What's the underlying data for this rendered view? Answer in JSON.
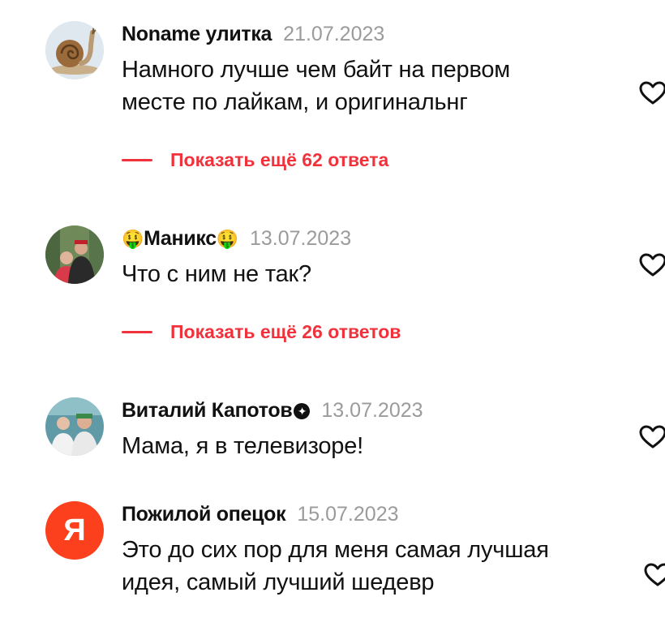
{
  "colors": {
    "accent": "#f0323c",
    "muted": "#9b9b9b",
    "yandex_red": "#fc3f1d"
  },
  "comments": [
    {
      "author": "Noname улитка",
      "date": "21.07.2023",
      "text_lines": [
        "Намного лучше чем байт на первом",
        "месте по лайкам, и оригинальнг"
      ],
      "replies_label": "Показать ещё 62 ответа",
      "avatar_icon": "snail-avatar"
    },
    {
      "author_prefix_icon": "🤑",
      "author": "Маникс",
      "author_suffix_icon": "🤑",
      "date": "13.07.2023",
      "text_lines": [
        "Что с ним не так?"
      ],
      "replies_label": "Показать ещё 26 ответов",
      "avatar_icon": "photo-avatar"
    },
    {
      "author": "Виталий Капотов",
      "author_badge_icon": "verified-badge-icon",
      "date": "13.07.2023",
      "text_lines": [
        "Мама, я в телевизоре!"
      ],
      "avatar_icon": "photo-avatar"
    },
    {
      "author": "Пожилой опецок",
      "date": "15.07.2023",
      "text_lines": [
        "Это до сих пор для меня самая лучшая",
        "идея, самый лучший шедевр"
      ],
      "avatar_icon": "yandex-logo-avatar",
      "avatar_letter": "Я"
    }
  ]
}
